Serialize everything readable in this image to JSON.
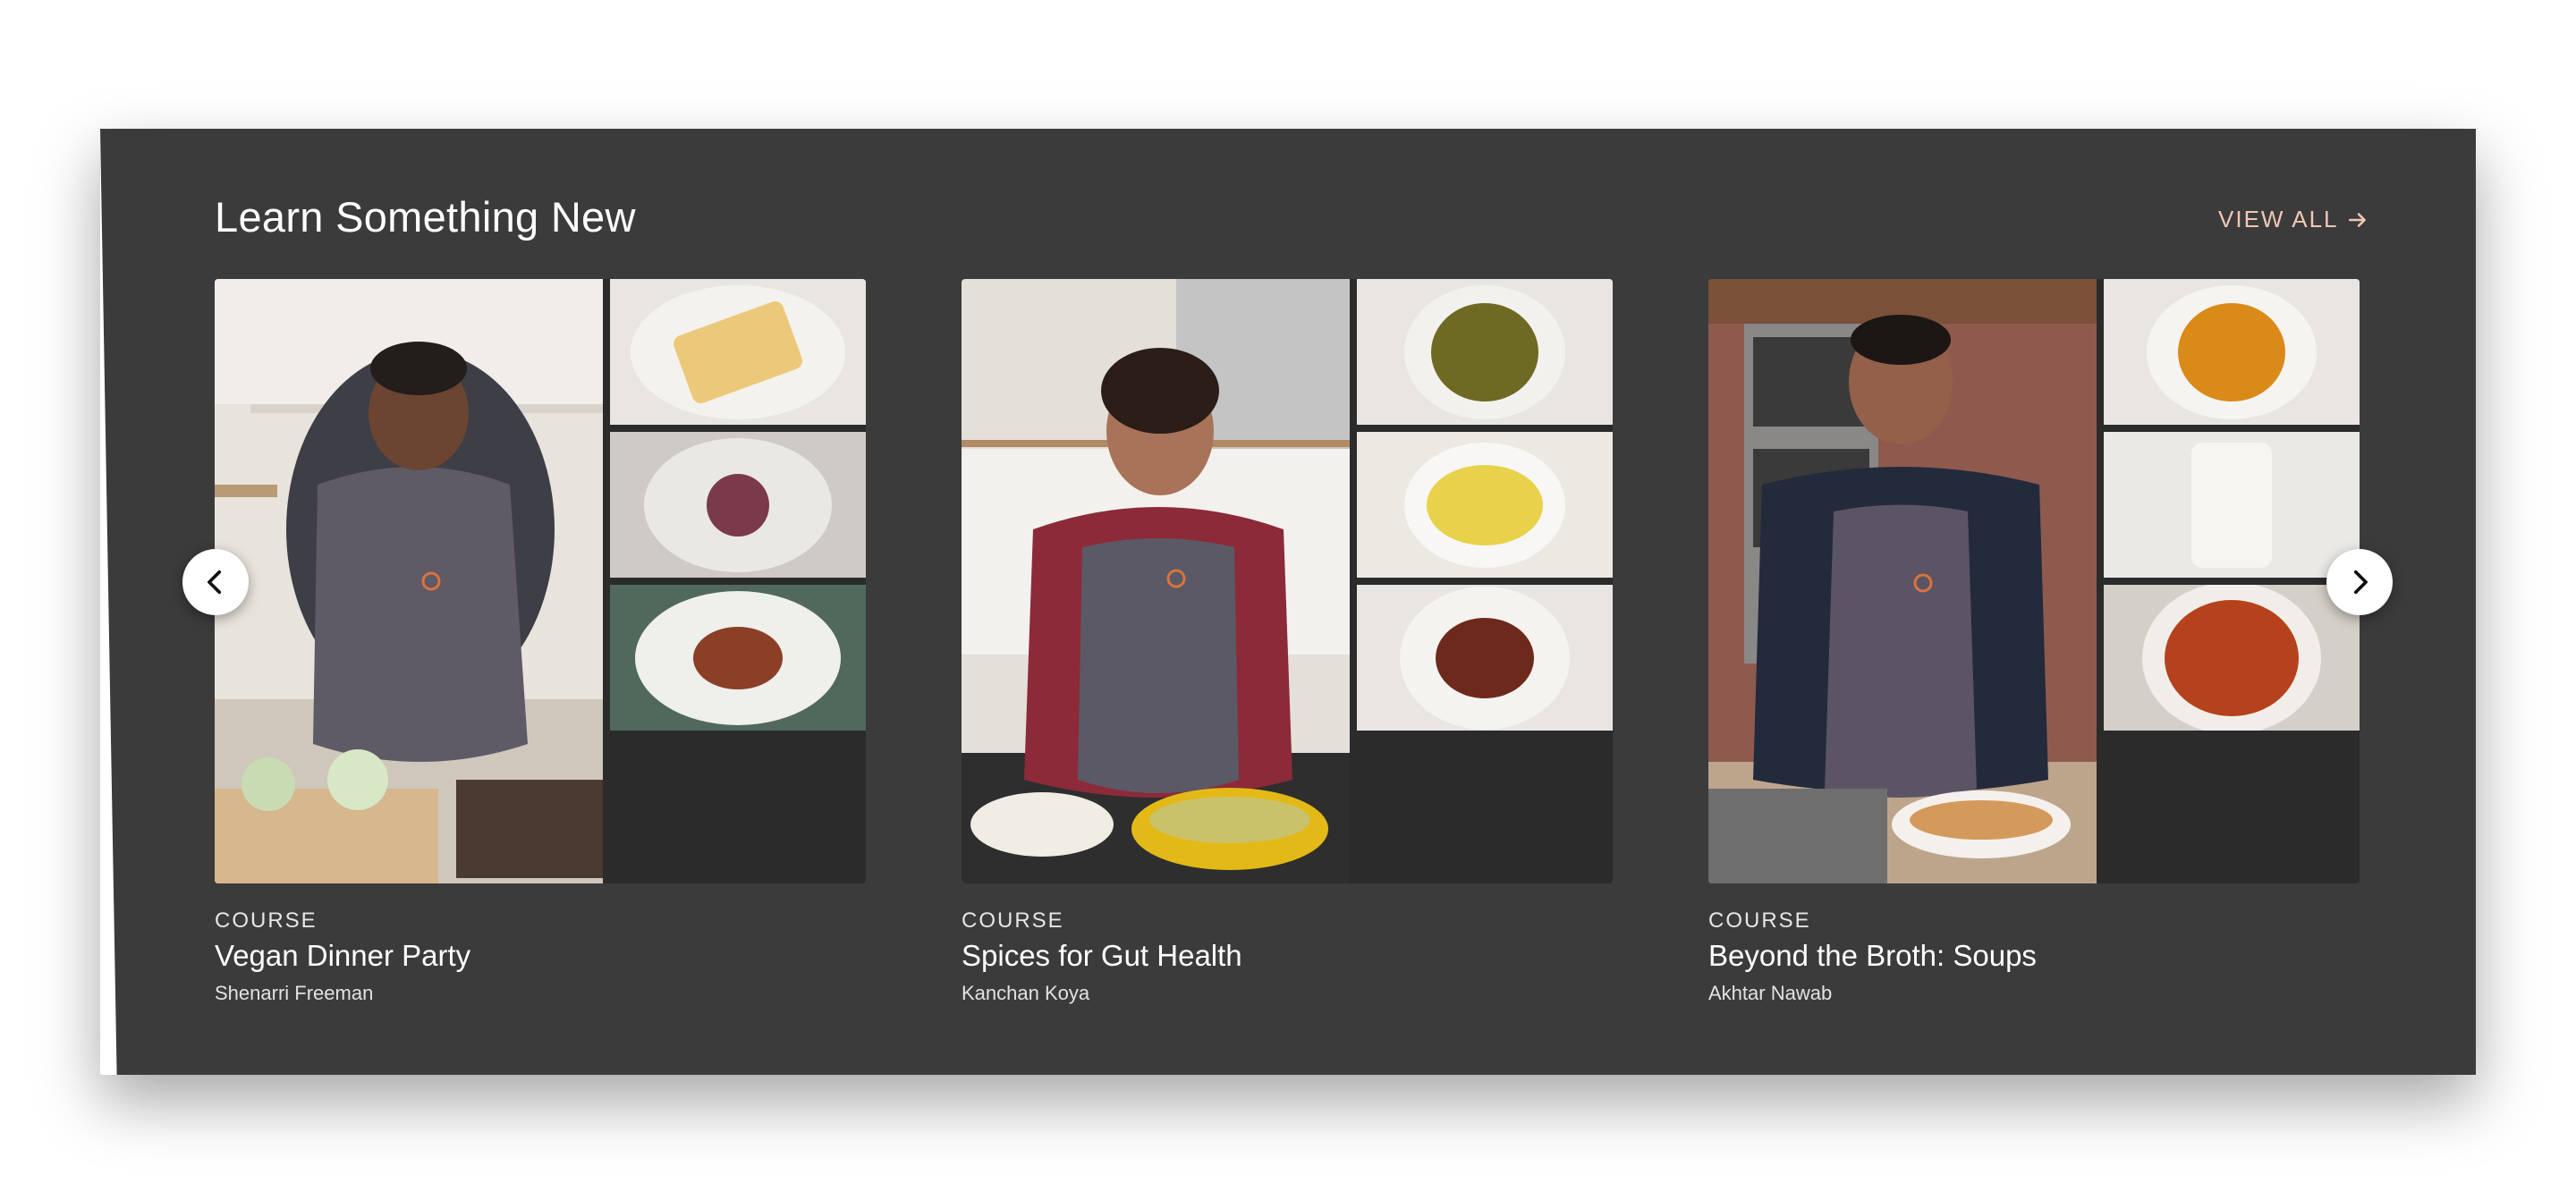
{
  "section": {
    "title": "Learn Something New",
    "view_all_label": "VIEW ALL"
  },
  "carousel": {
    "prev_icon": "chevron-left-icon",
    "next_icon": "chevron-right-icon"
  },
  "cards": [
    {
      "kicker": "COURSE",
      "title": "Vegan Dinner Party",
      "instructor": "Shenarri Freeman"
    },
    {
      "kicker": "COURSE",
      "title": "Spices for Gut Health",
      "instructor": "Kanchan Koya"
    },
    {
      "kicker": "COURSE",
      "title": "Beyond the Broth: Soups",
      "instructor": "Akhtar Nawab"
    }
  ],
  "colors": {
    "panel": "#3b3b3b",
    "accent": "#f0c7b4",
    "logo": "#d9743c"
  }
}
